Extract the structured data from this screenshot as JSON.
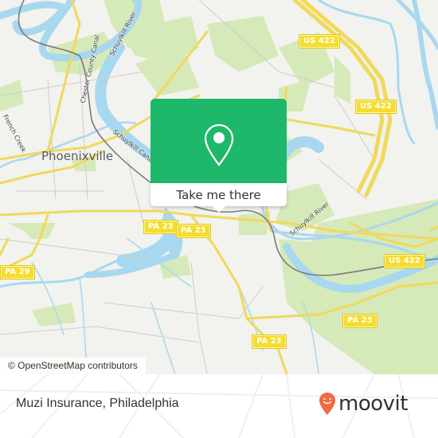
{
  "map": {
    "place_labels": [
      {
        "id": "phoenixville",
        "text": "Phoenixville"
      }
    ],
    "water_labels": [
      {
        "id": "chester-county-canal",
        "text": "Chester County Canal"
      },
      {
        "id": "schuylkill-river-north",
        "text": "Schuylkill River"
      },
      {
        "id": "schuylkill-canal",
        "text": "Schuylkill Canal"
      },
      {
        "id": "french-creek",
        "text": "French Creek"
      },
      {
        "id": "schuylkill-river-east",
        "text": "Schuylkill River"
      }
    ],
    "road_shields": [
      {
        "id": "us422-north",
        "text": "US 422"
      },
      {
        "id": "us422-mid",
        "text": "US 422"
      },
      {
        "id": "us422-east",
        "text": "US 422"
      },
      {
        "id": "pa23-west",
        "text": "PA 23"
      },
      {
        "id": "pa23-center",
        "text": "PA 23"
      },
      {
        "id": "pa23-east",
        "text": "PA 23"
      },
      {
        "id": "pa23-south",
        "text": "PA 23"
      },
      {
        "id": "pa29",
        "text": "PA 29"
      }
    ],
    "attribution": "© OpenStreetMap contributors",
    "colors": {
      "land": "#f2f2ee",
      "park": "#d4e8b5",
      "water": "#a8d8ef",
      "road": "#f4dd6a",
      "rail": "#707070"
    }
  },
  "popup": {
    "button_label": "Take me there",
    "icon": "map-pin-icon",
    "color": "#1eb86a"
  },
  "footer": {
    "title": "Muzi Insurance, Philadelphia",
    "logo_text": "moovit",
    "logo_icon": "moovit-pin-icon",
    "logo_color": "#f26a3d"
  }
}
